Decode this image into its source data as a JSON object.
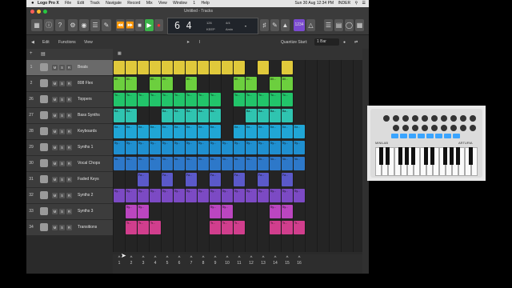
{
  "menubar": {
    "apple": "",
    "items": [
      "Logo Pro X",
      "File",
      "Edit",
      "Track",
      "Navigate",
      "Record",
      "Mix",
      "View",
      "Window",
      "1",
      "Help"
    ],
    "tray": [
      "Sun 30 Aug 12:34 PM",
      "INDER"
    ]
  },
  "window": {
    "title": "Untitled - Tracks",
    "lcd": {
      "bar": "6",
      "beat": "4",
      "tempo": "126",
      "tempo_label": "KEEP",
      "sig": "4/4",
      "key": "Amin"
    },
    "count_in": "1234"
  },
  "toolbar": {
    "edit": "Edit",
    "functions": "Functions",
    "view": "View",
    "quantize_label": "Quantize Start:",
    "quantize_value": "1 Bar"
  },
  "tracks": [
    {
      "num": "1",
      "name": "Beats",
      "icon": "drum-machine-icon"
    },
    {
      "num": "2",
      "name": "808 Flex",
      "icon": "drum-machine-icon"
    },
    {
      "num": "26",
      "name": "Toppers",
      "icon": "drum-kit-icon"
    },
    {
      "num": "27",
      "name": "Bass Synths",
      "icon": "synth-icon"
    },
    {
      "num": "28",
      "name": "Keyboards",
      "icon": "keyboard-icon"
    },
    {
      "num": "29",
      "name": "Synths 1",
      "icon": "keyboard-icon"
    },
    {
      "num": "30",
      "name": "Vocal Chops",
      "icon": "vocalist-icon"
    },
    {
      "num": "31",
      "name": "Faded Keys",
      "icon": "keyboard-icon"
    },
    {
      "num": "32",
      "name": "Synths 2",
      "icon": "keyboard-icon"
    },
    {
      "num": "33",
      "name": "Synths 3",
      "icon": "keyboard-icon"
    },
    {
      "num": "34",
      "name": "Transitions",
      "icon": "synth-icon"
    }
  ],
  "track_buttons": [
    "M",
    "S",
    "R"
  ],
  "grid": {
    "columns": 16,
    "rows": [
      {
        "color": "#e0c93b",
        "label": "",
        "cells": [
          1,
          1,
          1,
          1,
          1,
          1,
          1,
          1,
          1,
          1,
          1,
          0,
          1,
          0,
          1,
          0
        ]
      },
      {
        "color": "#6ccf3e",
        "label": "80...",
        "cells": [
          1,
          1,
          0,
          1,
          1,
          0,
          1,
          0,
          0,
          0,
          1,
          1,
          0,
          1,
          1,
          0
        ]
      },
      {
        "color": "#22c46a",
        "label": "To...",
        "cells": [
          1,
          1,
          1,
          1,
          1,
          1,
          1,
          1,
          1,
          0,
          1,
          1,
          1,
          1,
          1,
          0
        ]
      },
      {
        "color": "#2fc4b0",
        "label": "Ba...",
        "cells": [
          1,
          1,
          0,
          0,
          1,
          1,
          1,
          1,
          1,
          0,
          0,
          1,
          1,
          1,
          1,
          0
        ]
      },
      {
        "color": "#20a6d6",
        "label": "Ke...",
        "cells": [
          1,
          1,
          1,
          1,
          1,
          1,
          1,
          1,
          1,
          0,
          1,
          1,
          1,
          1,
          1,
          1
        ]
      },
      {
        "color": "#1f8fd0",
        "label": "Sy...",
        "cells": [
          1,
          1,
          1,
          1,
          1,
          1,
          1,
          1,
          1,
          1,
          1,
          1,
          1,
          1,
          1,
          1
        ]
      },
      {
        "color": "#2d78c9",
        "label": "Vo...",
        "cells": [
          1,
          1,
          1,
          1,
          1,
          1,
          1,
          1,
          1,
          1,
          1,
          1,
          1,
          1,
          1,
          1
        ]
      },
      {
        "color": "#5b59c9",
        "label": "Fa...",
        "cells": [
          0,
          0,
          1,
          0,
          1,
          0,
          1,
          0,
          1,
          0,
          1,
          0,
          1,
          0,
          1,
          0
        ]
      },
      {
        "color": "#7c4ac4",
        "label": "Sy...",
        "cells": [
          1,
          1,
          1,
          1,
          1,
          1,
          1,
          1,
          1,
          1,
          1,
          1,
          1,
          1,
          1,
          1
        ]
      },
      {
        "color": "#bb46c0",
        "label": "Sy...",
        "cells": [
          0,
          1,
          1,
          0,
          0,
          0,
          0,
          0,
          1,
          1,
          0,
          0,
          0,
          1,
          1,
          0
        ]
      },
      {
        "color": "#d13e8d",
        "label": "Tr...",
        "cells": [
          0,
          1,
          1,
          1,
          0,
          0,
          0,
          0,
          1,
          1,
          1,
          0,
          0,
          1,
          1,
          1
        ]
      }
    ]
  },
  "bottom": {
    "scenes": [
      "1",
      "2",
      "3",
      "4",
      "5",
      "6",
      "7",
      "8",
      "9",
      "10",
      "11",
      "12",
      "13",
      "14",
      "15",
      "16"
    ]
  },
  "photo": {
    "brand_left": "MINILAB",
    "brand_right": "ARTURIA"
  },
  "colors": {
    "selected_track": "#6a6a6a",
    "play": "#3bb44a",
    "record": "#d33",
    "accent": "#f0a030"
  }
}
